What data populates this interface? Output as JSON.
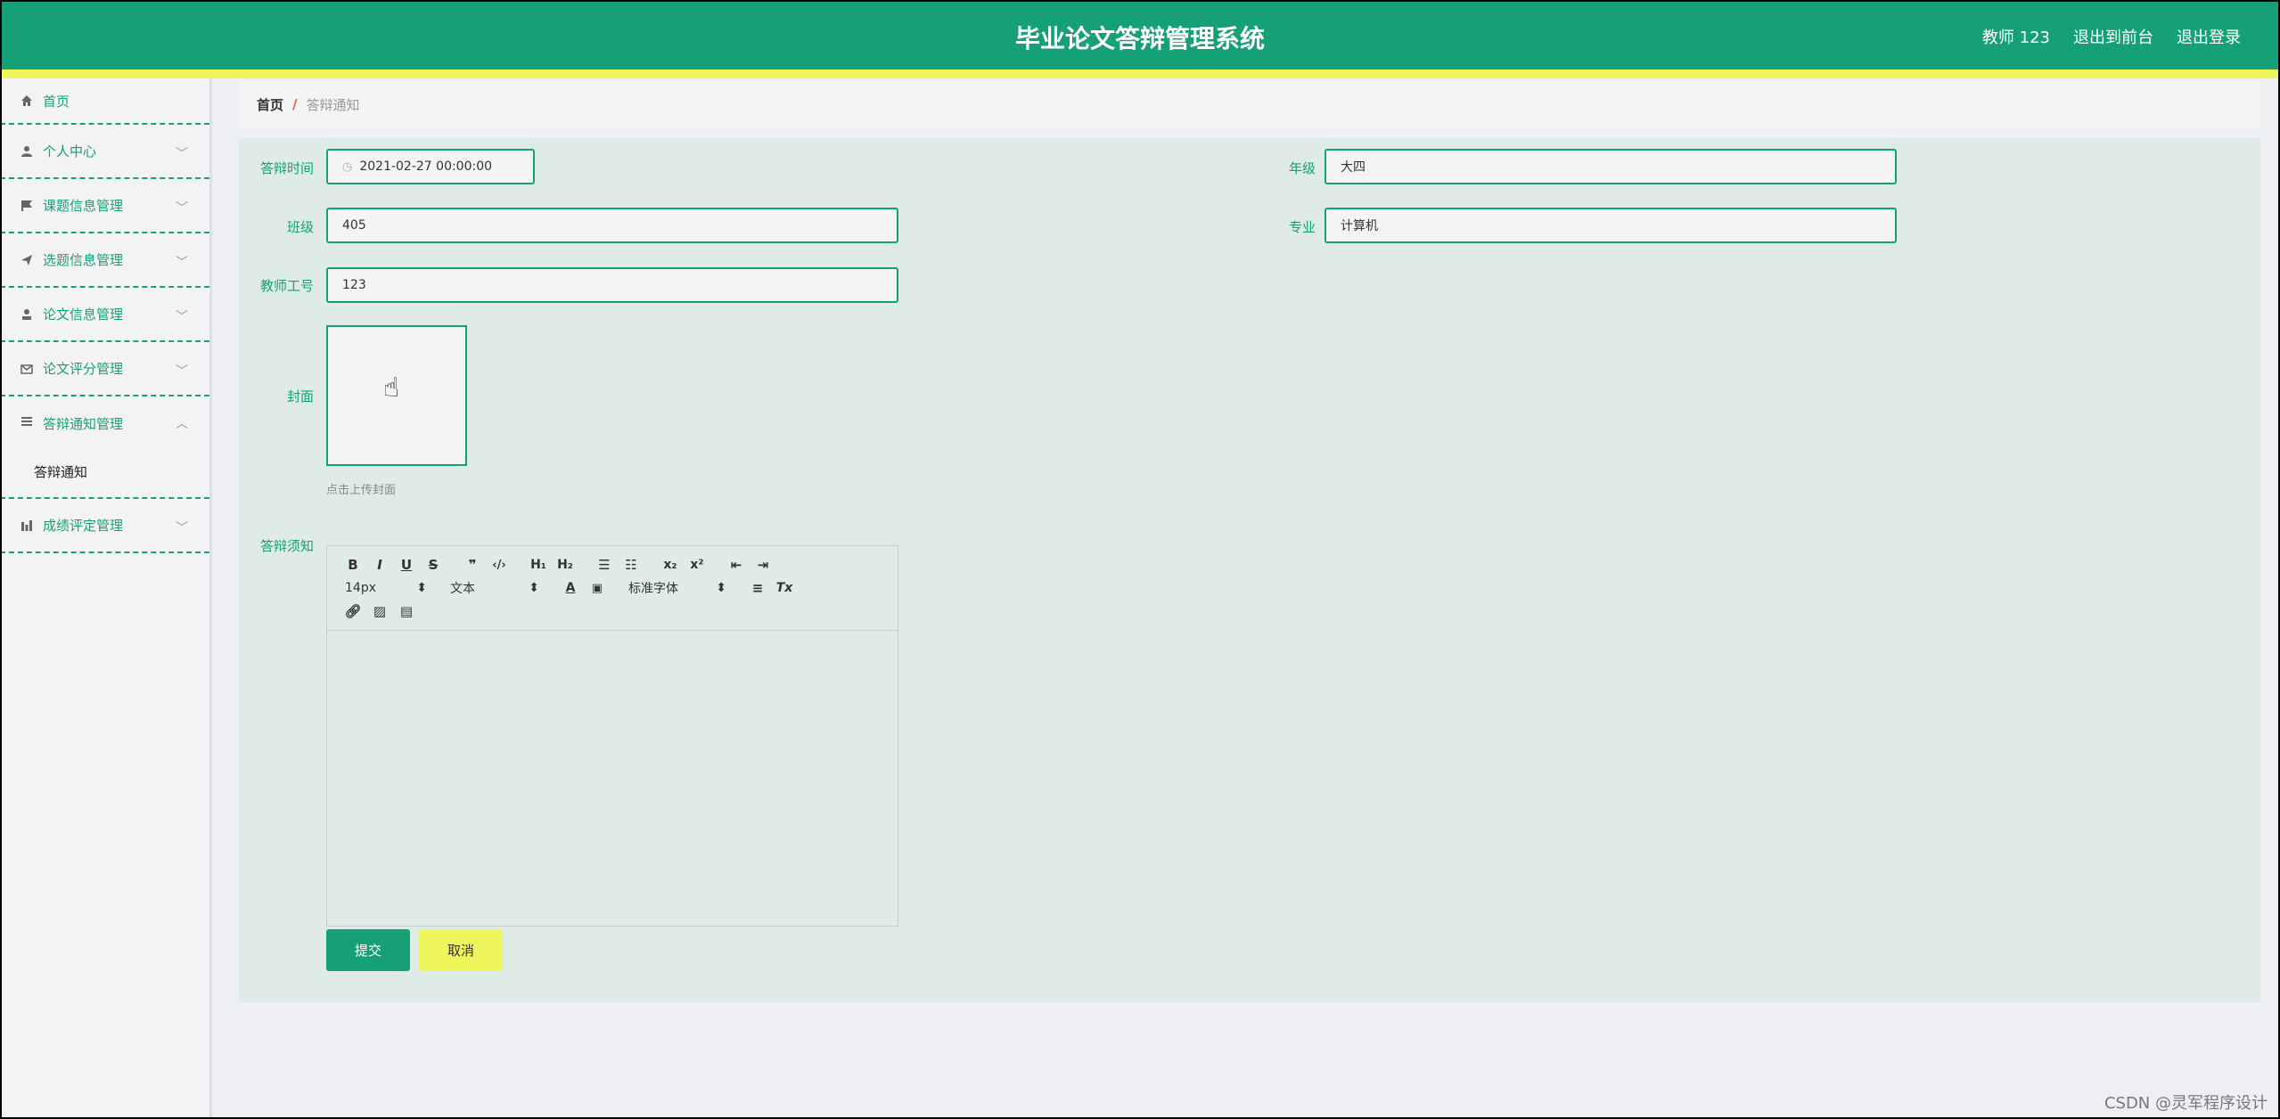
{
  "header": {
    "title": "毕业论文答辩管理系统",
    "user": "教师 123",
    "to_front": "退出到前台",
    "logout": "退出登录"
  },
  "sidebar": {
    "items": [
      {
        "label": "首页",
        "icon": "home-icon"
      },
      {
        "label": "个人中心",
        "icon": "user-icon"
      },
      {
        "label": "课题信息管理",
        "icon": "flag-icon"
      },
      {
        "label": "选题信息管理",
        "icon": "send-icon"
      },
      {
        "label": "论文信息管理",
        "icon": "stamp-icon"
      },
      {
        "label": "论文评分管理",
        "icon": "mail-icon"
      },
      {
        "label": "答辩通知管理",
        "icon": "list-icon",
        "children": [
          "答辩通知"
        ]
      },
      {
        "label": "成绩评定管理",
        "icon": "bar-chart-icon"
      }
    ]
  },
  "breadcrumb": {
    "home": "首页",
    "separator": "/",
    "current": "答辩通知"
  },
  "form": {
    "defense_time": {
      "label": "答辩时间",
      "value": "2021-02-27 00:00:00"
    },
    "grade": {
      "label": "年级",
      "value": "大四"
    },
    "class": {
      "label": "班级",
      "value": "405"
    },
    "major": {
      "label": "专业",
      "value": "计算机"
    },
    "teacher_id": {
      "label": "教师工号",
      "value": "123"
    },
    "cover": {
      "label": "封面",
      "hint": "点击上传封面"
    },
    "notice": {
      "label": "答辩须知"
    }
  },
  "editor": {
    "font_size": "14px",
    "text_type": "文本",
    "font_family": "标准字体"
  },
  "buttons": {
    "submit": "提交",
    "cancel": "取消"
  },
  "watermark": "CSDN @灵军程序设计",
  "colors": {
    "primary": "#16a075",
    "accent": "#eef65b",
    "panel": "#deebe6"
  }
}
